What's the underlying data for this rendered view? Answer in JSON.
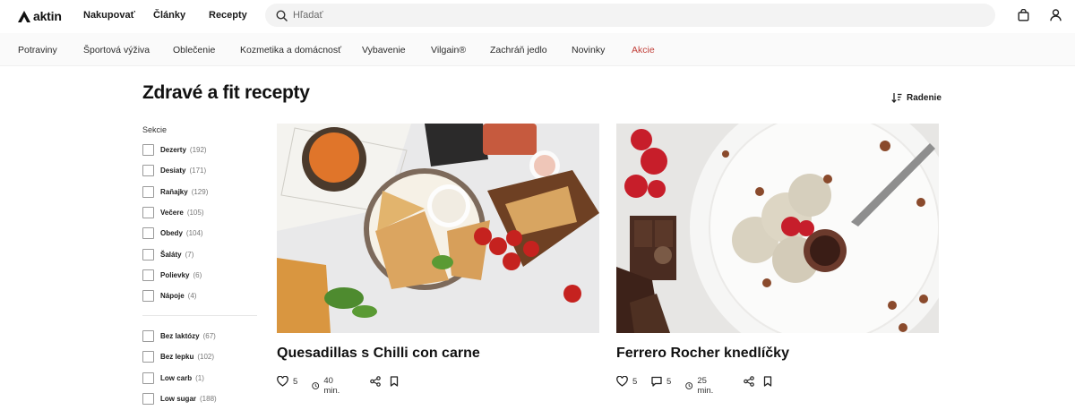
{
  "header": {
    "logo_text": "aktin",
    "nav": [
      "Nakupovať",
      "Články",
      "Recepty"
    ],
    "search_placeholder": "Hľadať",
    "icons": [
      "search-icon",
      "shopping-bag-icon",
      "user-icon"
    ]
  },
  "categories": [
    "Potraviny",
    "Športová výživa",
    "Oblečenie",
    "Kozmetika a domácnosť",
    "Vybavenie",
    "Vilgain®",
    "Zachráň jedlo",
    "Novinky",
    "Akcie"
  ],
  "colors": {
    "sale": "#c2413b",
    "search_bg": "#f3f3f3",
    "category_bar_bg": "#fafafa"
  },
  "page": {
    "title": "Zdravé a fit recepty",
    "sort_label": "Radenie"
  },
  "sidebar": {
    "section_title": "Sekcie",
    "sections": [
      {
        "label": "Dezerty",
        "count": "(192)"
      },
      {
        "label": "Desiaty",
        "count": "(171)"
      },
      {
        "label": "Raňajky",
        "count": "(129)"
      },
      {
        "label": "Večere",
        "count": "(105)"
      },
      {
        "label": "Obedy",
        "count": "(104)"
      },
      {
        "label": "Šaláty",
        "count": "(7)"
      },
      {
        "label": "Polievky",
        "count": "(6)"
      },
      {
        "label": "Nápoje",
        "count": "(4)"
      }
    ],
    "diets": [
      {
        "label": "Bez laktózy",
        "count": "(67)"
      },
      {
        "label": "Bez lepku",
        "count": "(102)"
      },
      {
        "label": "Low carb",
        "count": "(1)"
      },
      {
        "label": "Low sugar",
        "count": "(188)"
      }
    ]
  },
  "recipes": [
    {
      "title": "Quesadillas s Chilli con carne",
      "likes": "5",
      "time": "40 min."
    },
    {
      "title": "Ferrero Rocher knedlíčky",
      "likes": "5",
      "comments": "5",
      "time": "25 min."
    }
  ]
}
